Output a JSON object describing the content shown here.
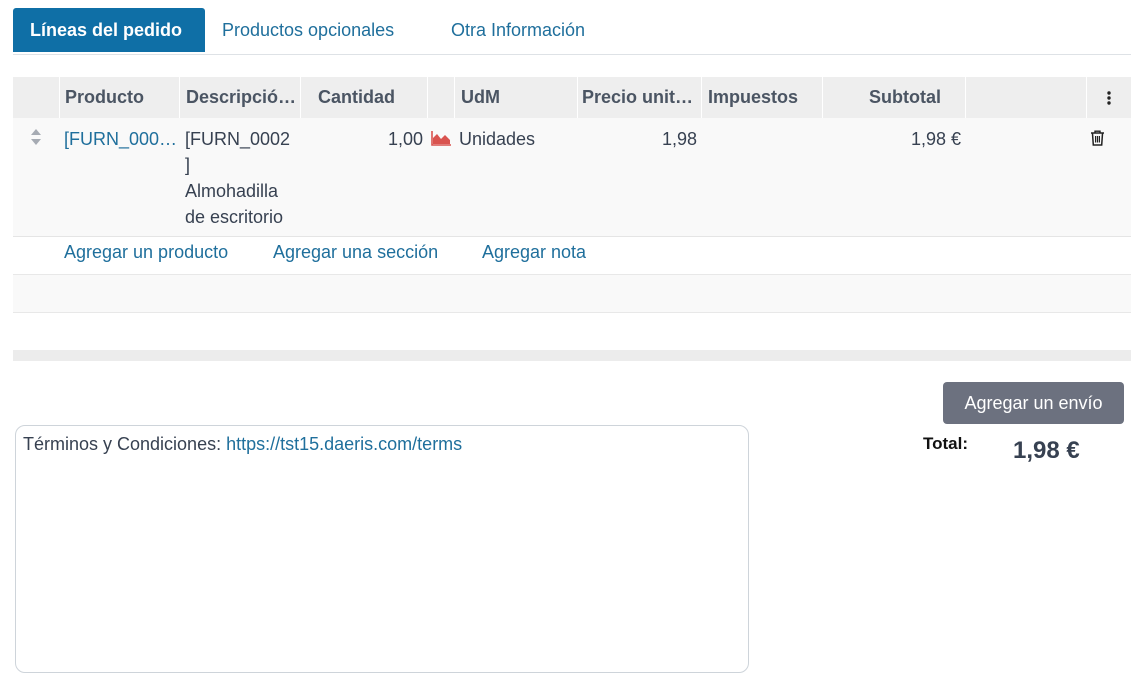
{
  "tabs": [
    {
      "label": "Líneas del pedido",
      "active": true
    },
    {
      "label": "Productos opcionales"
    },
    {
      "label": "Otra Información"
    }
  ],
  "table": {
    "headers": {
      "producto": "Producto",
      "descripcion": "Descripció…",
      "cantidad": "Cantidad",
      "udm": "UdM",
      "precio": "Precio unit…",
      "impuestos": "Impuestos",
      "subtotal": "Subtotal"
    },
    "rows": [
      {
        "producto": "[FURN_000…",
        "descripcion_line1": "[FURN_0002",
        "descripcion_line2": "]",
        "descripcion_line3": "Almohadilla",
        "descripcion_line4": "de escritorio",
        "cantidad": "1,00",
        "udm": "Unidades",
        "precio": "1,98",
        "impuestos": "",
        "subtotal": "1,98 €"
      }
    ],
    "add_links": {
      "product": "Agregar un producto",
      "section": "Agregar una sección",
      "note": "Agregar nota"
    }
  },
  "shipping_button": "Agregar un envío",
  "terms": {
    "label": "Términos y Condiciones: ",
    "url": "https://tst15.daeris.com/terms"
  },
  "total": {
    "label": "Total:",
    "value": "1,98 €"
  },
  "colors": {
    "accent": "#0f6fa6",
    "link": "#1f6f9c",
    "forecast_icon": "#d9534f",
    "button": "#6c717f"
  },
  "icons": {
    "drag_handle": "sort-arrows-icon",
    "forecast": "area-chart-icon",
    "delete": "trash-icon",
    "column_options": "vertical-dots-icon"
  }
}
